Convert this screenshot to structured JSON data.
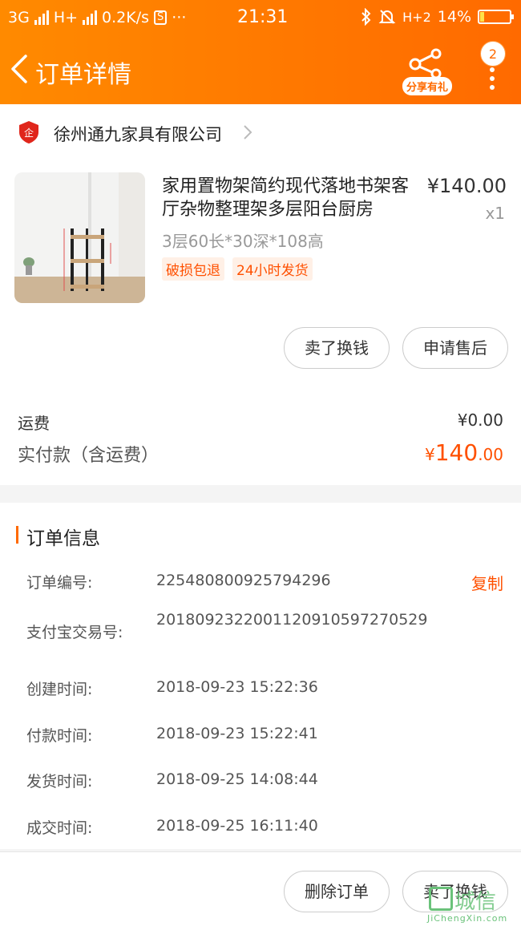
{
  "status_bar": {
    "net1": "3G",
    "net2": "H+",
    "speed": "0.2K/s",
    "dots": "···",
    "time": "21:31",
    "net3": "H+2",
    "battery": "14%",
    "battery_level": 0.14
  },
  "nav": {
    "title": "订单详情",
    "share_label": "分享有礼",
    "badge_count": "2"
  },
  "shop": {
    "name": "徐州通九家具有限公司",
    "logo_text": "企"
  },
  "item": {
    "title": "家用置物架简约现代落地书架客厅杂物整理架多层阳台厨房",
    "sku": "3层60长*30深*108高",
    "tags": [
      "破损包退",
      "24小时发货"
    ],
    "price": "¥140.00",
    "qty": "x1",
    "buttons": {
      "sell": "卖了换钱",
      "after_sale": "申请售后"
    }
  },
  "fees": {
    "shipping_label": "运费",
    "shipping_value": "¥0.00",
    "paid_label": "实付款（含运费）",
    "paid_currency": "¥",
    "paid_int": "140",
    "paid_dec": ".00"
  },
  "order_info": {
    "title": "订单信息",
    "copy_label": "复制",
    "rows": [
      {
        "label": "订单编号:",
        "value": "225480800925794296"
      },
      {
        "label": "支付宝交易号:",
        "value": "2018092322001120910597270529"
      },
      {
        "label": "创建时间:",
        "value": "2018-09-23 15:22:36"
      },
      {
        "label": "付款时间:",
        "value": "2018-09-23 15:22:41"
      },
      {
        "label": "发货时间:",
        "value": "2018-09-25 14:08:44"
      },
      {
        "label": "成交时间:",
        "value": "2018-09-25 16:11:40"
      }
    ]
  },
  "bottom_bar": {
    "delete": "删除订单",
    "sell": "卖了换钱"
  },
  "watermark": {
    "text": "城信",
    "url": "JiChengXin.com"
  },
  "colors": {
    "accent": "#ff6a00",
    "price": "#ff5000",
    "header_gradient_start": "#ff8a00"
  }
}
